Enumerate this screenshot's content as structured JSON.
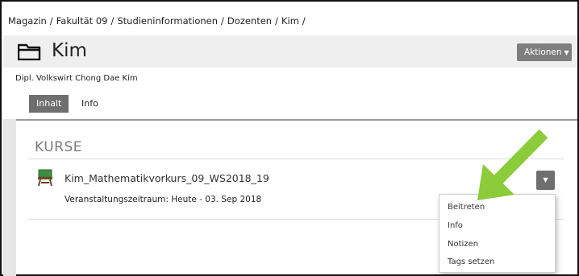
{
  "breadcrumb": {
    "items": [
      "Magazin",
      "Fakultät 09",
      "Studieninformationen",
      "Dozenten",
      "Kim"
    ],
    "separator": "/"
  },
  "header": {
    "icon": "folder-icon",
    "title": "Kim",
    "actions_label": "Aktionen"
  },
  "subtitle": "Dipl. Volkswirt Chong Dae Kim",
  "tabs": [
    {
      "label": "Inhalt",
      "active": true
    },
    {
      "label": "Info",
      "active": false
    }
  ],
  "section": {
    "title": "KURSE"
  },
  "course": {
    "icon": "classroom-board-icon",
    "title": "Kim_Mathematikvorkurs_09_WS2018_19",
    "period": "Veranstaltungszeitraum: Heute - 03. Sep 2018"
  },
  "dropdown_menu": {
    "items": [
      "Beitreten",
      "Info",
      "Notizen",
      "Tags setzen"
    ]
  },
  "colors": {
    "annotation_arrow": "#8ccb3a",
    "header_bg": "#efefef",
    "button_bg": "#7e7e7e",
    "course_icon_green": "#3f8e3f",
    "course_icon_brown": "#6b4a2a"
  }
}
